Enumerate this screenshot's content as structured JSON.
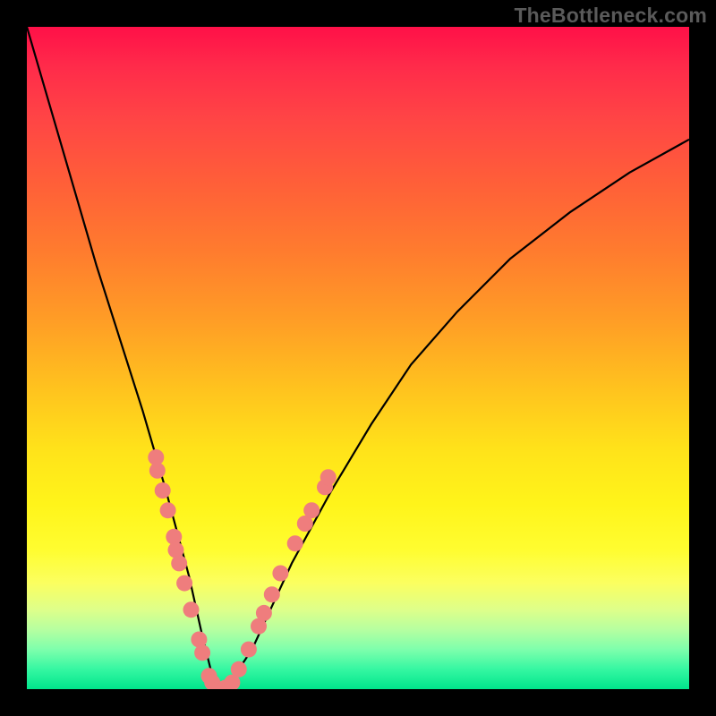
{
  "watermark": "TheBottleneck.com",
  "colors": {
    "background": "#000000",
    "curve_stroke": "#000000",
    "marker_fill": "#ef7d7d",
    "marker_stroke": "#d86a6a"
  },
  "chart_data": {
    "type": "line",
    "title": "",
    "xlabel": "",
    "ylabel": "",
    "xlim": [
      0,
      1
    ],
    "ylim": [
      0,
      1
    ],
    "note": "No numeric axis ticks or labels are visible; values are normalized estimates read from pixel positions.",
    "series": [
      {
        "name": "curve",
        "x": [
          0.0,
          0.035,
          0.07,
          0.105,
          0.14,
          0.175,
          0.21,
          0.245,
          0.265,
          0.28,
          0.3,
          0.34,
          0.4,
          0.46,
          0.52,
          0.58,
          0.65,
          0.73,
          0.82,
          0.91,
          1.0
        ],
        "y": [
          1.0,
          0.88,
          0.76,
          0.64,
          0.53,
          0.42,
          0.3,
          0.17,
          0.08,
          0.02,
          0.0,
          0.06,
          0.19,
          0.3,
          0.4,
          0.49,
          0.57,
          0.65,
          0.72,
          0.78,
          0.83
        ]
      }
    ],
    "markers": [
      {
        "x": 0.195,
        "y": 0.35
      },
      {
        "x": 0.197,
        "y": 0.33
      },
      {
        "x": 0.205,
        "y": 0.3
      },
      {
        "x": 0.213,
        "y": 0.27
      },
      {
        "x": 0.222,
        "y": 0.23
      },
      {
        "x": 0.225,
        "y": 0.21
      },
      {
        "x": 0.23,
        "y": 0.19
      },
      {
        "x": 0.238,
        "y": 0.16
      },
      {
        "x": 0.248,
        "y": 0.12
      },
      {
        "x": 0.26,
        "y": 0.075
      },
      {
        "x": 0.265,
        "y": 0.055
      },
      {
        "x": 0.275,
        "y": 0.02
      },
      {
        "x": 0.28,
        "y": 0.01
      },
      {
        "x": 0.29,
        "y": 0.0
      },
      {
        "x": 0.3,
        "y": 0.002
      },
      {
        "x": 0.31,
        "y": 0.01
      },
      {
        "x": 0.32,
        "y": 0.03
      },
      {
        "x": 0.335,
        "y": 0.06
      },
      {
        "x": 0.35,
        "y": 0.095
      },
      {
        "x": 0.358,
        "y": 0.115
      },
      {
        "x": 0.37,
        "y": 0.143
      },
      {
        "x": 0.383,
        "y": 0.175
      },
      {
        "x": 0.405,
        "y": 0.22
      },
      {
        "x": 0.42,
        "y": 0.25
      },
      {
        "x": 0.43,
        "y": 0.27
      },
      {
        "x": 0.45,
        "y": 0.305
      },
      {
        "x": 0.455,
        "y": 0.32
      }
    ]
  }
}
